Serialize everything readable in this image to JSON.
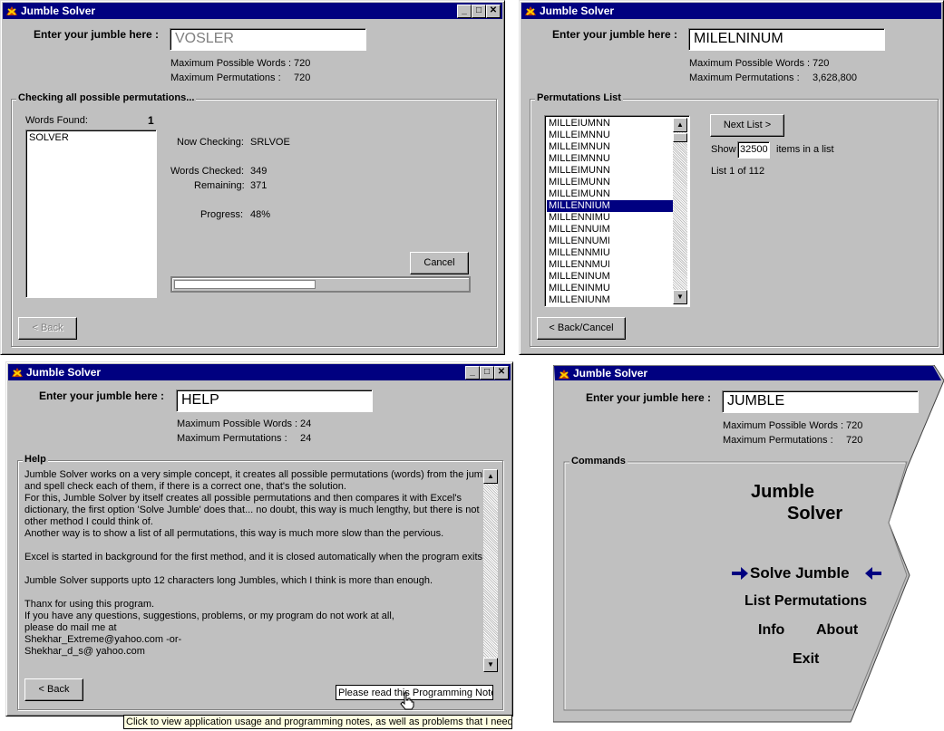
{
  "w1": {
    "title": "Jumble Solver",
    "prompt": "Enter your jumble here :",
    "input_value": "VOSLER",
    "max_words_label": "Maximum Possible Words :",
    "max_words_value": "720",
    "max_perms_label": "Maximum Permutations :",
    "max_perms_value": "720",
    "group_label": "Checking all possible permutations...",
    "words_found_label": "Words Found:",
    "words_found_value": "1",
    "found_words": [
      "SOLVER"
    ],
    "now_checking_label": "Now Checking:",
    "now_checking_value": "SRLVOE",
    "words_checked_label": "Words Checked:",
    "words_checked_value": "349",
    "remaining_label": "Remaining:",
    "remaining_value": "371",
    "progress_label": "Progress:",
    "progress_value": "48%",
    "progress_fraction": 0.48,
    "cancel_label": "Cancel",
    "back_label": "< Back"
  },
  "w2": {
    "title": "Jumble Solver",
    "prompt": "Enter your jumble here :",
    "input_value": "MILELNINUM",
    "max_words_label": "Maximum Possible Words :",
    "max_words_value": "720",
    "max_perms_label": "Maximum Permutations :",
    "max_perms_value": "3,628,800",
    "group_label": "Permutations List",
    "permutations": [
      "MILLEIUMNN",
      "MILLEIMNNU",
      "MILLEIMNUN",
      "MILLEIMUNN",
      "MILLEIMUNN",
      "MILLEIMUNN",
      "MILLEIMUNN",
      "MILLENNIUM",
      "MILLENNIMU",
      "MILLENNUIM",
      "MILLENNUMI",
      "MILLENNMIU",
      "MILLENNMUI",
      "MILLENINUM",
      "MILLENINMU",
      "MILLENIUNM"
    ],
    "perm_display": [
      "MILLEIUMNN",
      "MILLEIMNNU",
      "MILLEIMNUN",
      "MILLEIMNNU",
      "MILLEIMUNN",
      "MILLEIMUNN",
      "MILLEIMUNN",
      "MILLENNIUM",
      "MILLENNIMU",
      "MILLENNUIM",
      "MILLENNUMI",
      "MILLENNMIU",
      "MILLENNMUI",
      "MILLENINUM",
      "MILLENINMU",
      "MILLENIUNM"
    ],
    "selected_index": 7,
    "next_list_label": "Next List >",
    "show_label": "Show",
    "show_value": "32500",
    "items_label": "items in a list",
    "list_status": "List 1 of 112",
    "back_cancel_label": "< Back/Cancel"
  },
  "w3": {
    "title": "Jumble Solver",
    "prompt": "Enter your jumble here :",
    "input_value": "HELP",
    "max_words_label": "Maximum Possible Words :",
    "max_words_value": "24",
    "max_perms_label": "Maximum Permutations :",
    "max_perms_value": "24",
    "group_label": "Help",
    "help_lines": [
      "Jumble Solver works on a very simple concept, it creates all possible permutations (words) from the jumble",
      "and spell check each of them, if there is a correct one, that's the solution.",
      "For this, Jumble Solver by itself creates all possible permutations and then compares it with Excel's",
      "dictionary, the first option 'Solve Jumble' does that... no doubt, this way is much lengthy, but there is not",
      "other method I could think of.",
      "Another way is to show a list of all permutations, this way is much more slow than the pervious.",
      "",
      "Excel is started in background for the first method, and it is closed automatically when the program exits.",
      "",
      "Jumble Solver supports upto 12 characters long Jumbles, which I think is more than enough.",
      "",
      "Thanx for using this program.",
      "If you have any questions, suggestions, problems, or my program do not work at all,",
      "please do mail me at",
      "Shekhar_Extreme@yahoo.com -or-",
      "Shekhar_d_s@ yahoo.com"
    ],
    "back_label": "< Back",
    "notes_link": "Please read this Programming Notes",
    "tooltip": "Click to view application usage and programming notes, as well as problems that I need to :"
  },
  "w4": {
    "title": "Jumble Solver",
    "prompt": "Enter your jumble here :",
    "input_value": "JUMBLE",
    "max_words_label": "Maximum Possible Words :",
    "max_words_value": "720",
    "max_perms_label": "Maximum Permutations :",
    "max_perms_value": "720",
    "group_label": "Commands",
    "logo_line1": "Jumble",
    "logo_line2": "Solver",
    "solve_label": "Solve Jumble",
    "list_label": "List Permutations",
    "info_label": "Info",
    "about_label": "About",
    "exit_label": "Exit"
  },
  "colors": {
    "titlebar": "#000080",
    "face": "#c0c0c0",
    "selection": "#000080"
  }
}
